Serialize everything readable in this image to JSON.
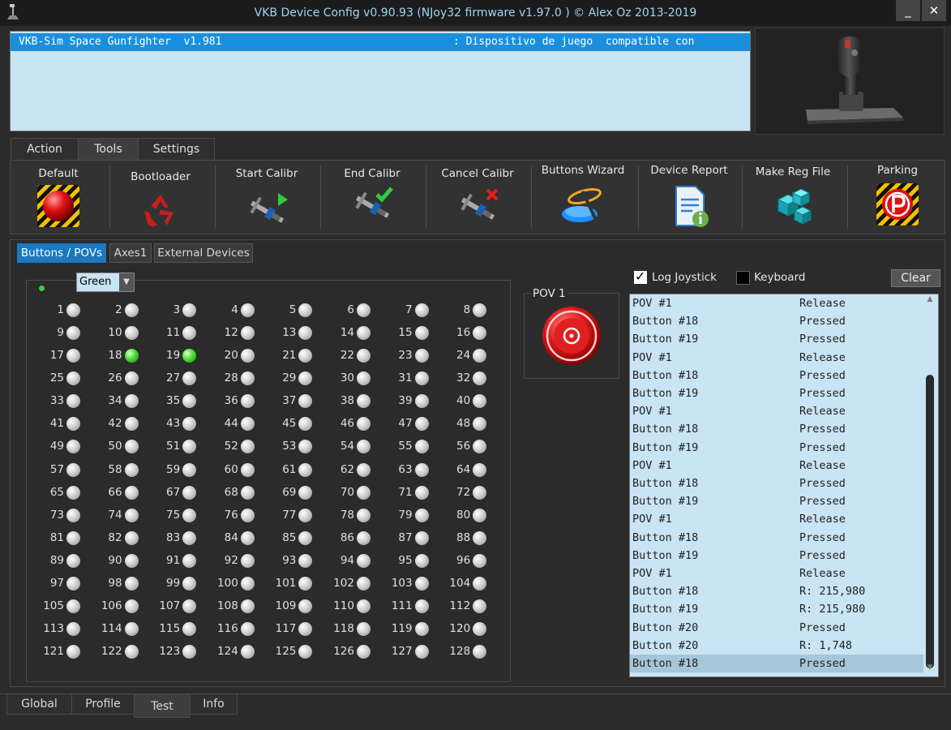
{
  "window": {
    "title": "VKB Device Config v0.90.93 (NJoy32 firmware v1.97.0  ) © Alex Oz 2013-2019",
    "minimize_label": "_",
    "close_label": "✕"
  },
  "device_list": {
    "name": "VKB-Sim Space Gunfighter  v1.981",
    "description": ": Dispositivo de juego  compatible con"
  },
  "main_tabs": [
    "Action",
    "Tools",
    "Settings"
  ],
  "toolbar": [
    {
      "label": "Default",
      "icon": "red-button-icon"
    },
    {
      "label": "Bootloader",
      "icon": "recycle-icon"
    },
    {
      "label": "Start Calibr",
      "icon": "caliper-play-icon"
    },
    {
      "label": "End Calibr",
      "icon": "caliper-check-icon"
    },
    {
      "label": "Cancel Calibr",
      "icon": "caliper-cancel-icon"
    },
    {
      "label": "Buttons Wizard",
      "icon": "wizard-wand-icon"
    },
    {
      "label": "Device Report",
      "icon": "document-info-icon"
    },
    {
      "label": "Make Reg File",
      "icon": "registry-cubes-icon"
    },
    {
      "label": "Parking",
      "icon": "parking-icon"
    }
  ],
  "sub_tabs": [
    "Buttons / POVs",
    "Axes1",
    "External Devices"
  ],
  "color_select": {
    "value": "Green"
  },
  "buttons": {
    "count": 128,
    "pressed": [
      18,
      19
    ]
  },
  "pov": {
    "label": "POV 1"
  },
  "log_options": {
    "log_joystick_label": "Log Joystick",
    "log_joystick_checked": true,
    "keyboard_label": "Keyboard",
    "keyboard_checked": false,
    "clear_label": "Clear",
    "check_mark": "✓"
  },
  "log": [
    {
      "item": "POV #1",
      "state": "Release"
    },
    {
      "item": "Button #18",
      "state": "Pressed"
    },
    {
      "item": "Button #19",
      "state": "Pressed"
    },
    {
      "item": "POV #1",
      "state": "Release"
    },
    {
      "item": "Button #18",
      "state": "Pressed"
    },
    {
      "item": "Button #19",
      "state": "Pressed"
    },
    {
      "item": "POV #1",
      "state": "Release"
    },
    {
      "item": "Button #18",
      "state": "Pressed"
    },
    {
      "item": "Button #19",
      "state": "Pressed"
    },
    {
      "item": "POV #1",
      "state": "Release"
    },
    {
      "item": "Button #18",
      "state": "Pressed"
    },
    {
      "item": "Button #19",
      "state": "Pressed"
    },
    {
      "item": "POV #1",
      "state": "Release"
    },
    {
      "item": "Button #18",
      "state": "Pressed"
    },
    {
      "item": "Button #19",
      "state": "Pressed"
    },
    {
      "item": "POV #1",
      "state": "Release"
    },
    {
      "item": "Button #18",
      "state": "R: 215,980"
    },
    {
      "item": "Button #19",
      "state": "R: 215,980"
    },
    {
      "item": "Button #20",
      "state": "Pressed"
    },
    {
      "item": "Button #20",
      "state": "R: 1,748"
    },
    {
      "item": "Button #18",
      "state": "Pressed"
    }
  ],
  "bottom_tabs": [
    "Global",
    "Profile",
    "Test",
    "Info"
  ],
  "colors": {
    "accent": "#1b8fde",
    "list_bg": "#c9e4f4",
    "led_on": "#48e030",
    "title_text": "#9fd4f2"
  }
}
